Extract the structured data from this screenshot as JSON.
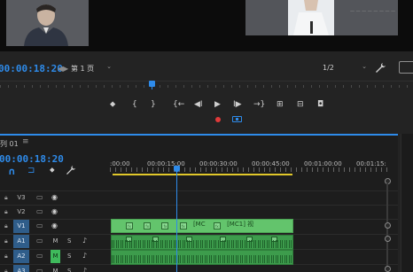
{
  "source_monitor": {
    "timecode": "00:00:18:20",
    "page_select": "第 1 页",
    "scale_select": "1/2",
    "nav_left_symbol": "◀",
    "nav_right_symbol": "▶"
  },
  "program_monitor": {
    "watermark": "— — — — — — — —"
  },
  "transport": {
    "buttons": [
      "mark-in-icon",
      "bracket-open",
      "bracket-close",
      "go-to-in-icon",
      "step-back-icon",
      "play-icon",
      "step-forward-icon",
      "go-to-out-icon",
      "insert-icon",
      "overwrite-icon",
      "camera-icon"
    ],
    "symbols": {
      "marker": "⬥",
      "bracket_open": "{",
      "bracket_close": "}",
      "go_in": "{←",
      "step_back": "◀I",
      "play": "▶",
      "step_fwd": "I▶",
      "go_out": "→}",
      "insert": "⊞",
      "overwrite": "⊟",
      "camera": "◘"
    }
  },
  "timeline": {
    "title": "列 01",
    "menu_symbol": "≡",
    "timecode": "00:00:18:20",
    "tool_symbols": {
      "snap": "∩",
      "link": "⊐",
      "marker": "⬥",
      "wrench": "🔧"
    },
    "ruler_labels": [
      ":00:00",
      "00:00:15:00",
      "00:00:30:00",
      "00:00:45:00",
      "00:01:00:00",
      "00:01:15:"
    ],
    "tracks": [
      {
        "target": "V3",
        "type": "video",
        "targeted": false
      },
      {
        "target": "V2",
        "type": "video",
        "targeted": false
      },
      {
        "target": "V1",
        "type": "video",
        "targeted": true
      },
      {
        "target": "A1",
        "type": "audio",
        "targeted": true,
        "mute_active": false
      },
      {
        "target": "A2",
        "type": "audio",
        "targeted": true,
        "mute_active": true
      },
      {
        "target": "A3",
        "type": "audio",
        "targeted": true,
        "mute_active": false
      }
    ],
    "track_labels": {
      "mute": "M",
      "solo": "S",
      "lock_symbol": "🔒",
      "film_symbol": "▭",
      "eye_symbol": "👁",
      "mic_symbol": "🎤"
    },
    "video_clip_labels": [
      "[MC",
      "[MC1] 视"
    ]
  },
  "colors": {
    "accent_blue": "#2e8bea",
    "clip_video": "#63c46c",
    "clip_audio": "#3d9c4c",
    "work_area": "#e1c82a",
    "record": "#e03a3a",
    "mute_on": "#3fba5c"
  }
}
